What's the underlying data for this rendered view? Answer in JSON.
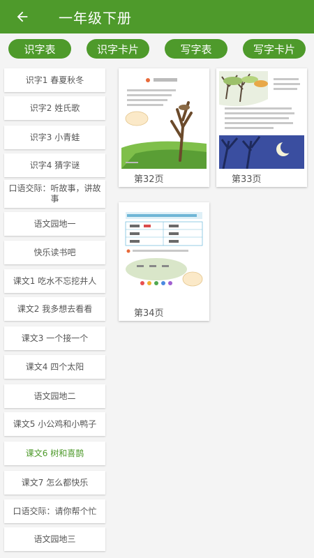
{
  "header": {
    "title": "一年级下册",
    "back_icon": "arrow-left-icon"
  },
  "tabs": [
    "识字表",
    "识字卡片",
    "写字表",
    "写字卡片"
  ],
  "colors": {
    "primary": "#4e9a2b",
    "active_text": "#4e9a2b"
  },
  "sidebar": {
    "items": [
      "识字1 春夏秋冬",
      "识字2 姓氏歌",
      "识字3 小青蛙",
      "识字4 猜字谜",
      "口语交际：听故事，讲故事",
      "语文园地一",
      "快乐读书吧",
      "课文1 吃水不忘挖井人",
      "课文2 我多想去看看",
      "课文3 一个接一个",
      "课文4 四个太阳",
      "语文园地二",
      "课文5 小公鸡和小鸭子",
      "课文6 树和喜鹊",
      "课文7 怎么都快乐",
      "口语交际：请你帮个忙",
      "语文园地三"
    ],
    "active_item": "课文6 树和喜鹊"
  },
  "pages": [
    {
      "label": "第32页",
      "thumb": "page-thumb-32"
    },
    {
      "label": "第33页",
      "thumb": "page-thumb-33"
    },
    {
      "label": "第34页",
      "thumb": "page-thumb-34"
    }
  ]
}
